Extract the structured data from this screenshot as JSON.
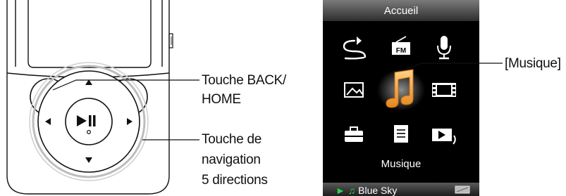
{
  "labels": {
    "back_home_line1": "Touche BACK/",
    "back_home_line2": "HOME",
    "nav_line1": "Touche de",
    "nav_line2": "navigation",
    "nav_line3": "5 directions",
    "music_callout": "[Musique]"
  },
  "screen": {
    "title": "Accueil",
    "caption": "Musique",
    "now_playing_prefix": "► ♫",
    "now_playing": "Blue Sky"
  },
  "icons": {
    "row1": [
      "repeat-icon",
      "fm-radio-icon",
      "microphone-icon"
    ],
    "row2": [
      "photo-icon",
      "music-note-icon",
      "video-icon"
    ],
    "row3": [
      "toolbox-icon",
      "document-icon",
      "playlist-icon"
    ]
  },
  "colors": {
    "screen_bg": "#000000",
    "header_gradient_top": "#6a6a6a",
    "selected_icon": "#f3a23c",
    "accent_green": "#2bd14a"
  }
}
